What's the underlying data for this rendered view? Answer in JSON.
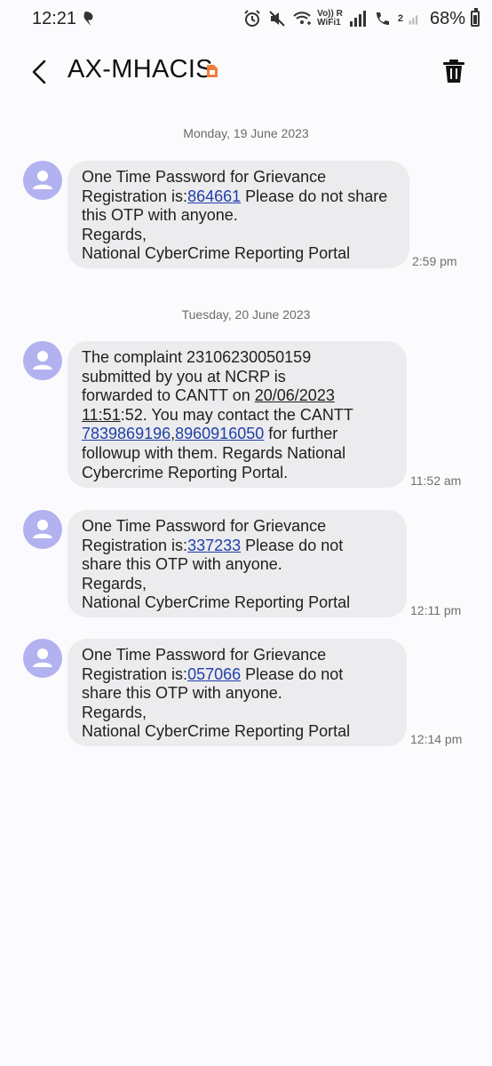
{
  "status_bar": {
    "time": "12:21",
    "volte_label": "Vo)) R",
    "wifi_label": "WiFi1",
    "sim_label": "2",
    "battery_percent": "68%",
    "battery_level": 0.68
  },
  "header": {
    "contact_name": "AX-MHACIS"
  },
  "dates": {
    "d1": "Monday, 19 June 2023",
    "d2": "Tuesday, 20 June 2023"
  },
  "messages": [
    {
      "time": "2:59 pm",
      "l1": "One Time Password for Grievance",
      "l2a": "Registration is:",
      "l2b": "864661",
      "l2c": " Please do not share",
      "l3": "this OTP with anyone.",
      "l4": "Regards,",
      "l5": "National CyberCrime Reporting Portal"
    },
    {
      "time": "11:52 am",
      "l1": "The complaint 23106230050159",
      "l2": "submitted by you at NCRP is",
      "l3a": "forwarded to CANTT on ",
      "l3b": "20/06/2023",
      "l4a": "11:51",
      "l4b": ":52. You may contact the CANTT",
      "l5a": "7839869196",
      "l5b": ",",
      "l5c": "8960916050",
      "l5d": " for further",
      "l6": "followup with them. Regards National",
      "l7": "Cybercrime Reporting Portal."
    },
    {
      "time": "12:11 pm",
      "l1": "One Time Password for Grievance",
      "l2a": "Registration is:",
      "l2b": "337233",
      "l2c": " Please do not",
      "l3": "share this OTP with anyone.",
      "l4": "Regards,",
      "l5": "National CyberCrime Reporting Portal"
    },
    {
      "time": "12:14 pm",
      "l1": "One Time Password for Grievance",
      "l2a": "Registration is:",
      "l2b": "057066",
      "l2c": " Please do not",
      "l3": "share this OTP with anyone.",
      "l4": "Regards,",
      "l5": "National CyberCrime Reporting Portal"
    }
  ],
  "icons": {
    "back": "back-arrow-icon",
    "delete": "trash-icon",
    "avatar": "person-icon",
    "sim": "sim-badge-icon"
  },
  "colors": {
    "bubble": "#ececee",
    "avatar": "#b3b2f0",
    "link": "#1f3fa8",
    "sim_badge": "#f07d3c"
  }
}
